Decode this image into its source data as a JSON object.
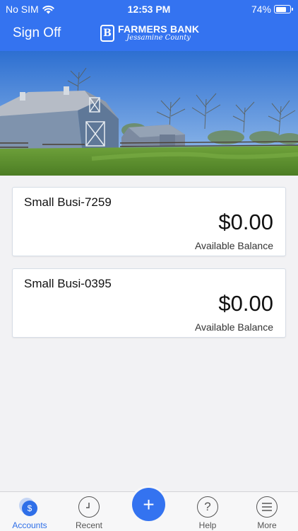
{
  "status_bar": {
    "carrier": "No SIM",
    "time": "12:53 PM",
    "battery": "74%",
    "battery_level": 0.74,
    "wifi_icon": "wifi-icon"
  },
  "header": {
    "sign_off_label": "Sign Off",
    "logo": {
      "name": "FARMERS BANK",
      "subtitle": "Jessamine County",
      "mark": "B"
    },
    "color": "#3473f0"
  },
  "accounts": [
    {
      "name": "Small Busi-7259",
      "amount": "$0.00",
      "label": "Available Balance"
    },
    {
      "name": "Small Busi-0395",
      "amount": "$0.00",
      "label": "Available Balance"
    }
  ],
  "tabbar": {
    "tabs": [
      {
        "label": "Accounts",
        "icon": "dollar-icon",
        "glyph": "$",
        "active": true
      },
      {
        "label": "Recent",
        "icon": "clock-icon",
        "glyph": ""
      },
      {
        "label": "Help",
        "icon": "question-icon",
        "glyph": "?"
      },
      {
        "label": "More",
        "icon": "menu-icon",
        "glyph": "≡"
      }
    ],
    "fab_glyph": "+",
    "accent": "#2f6fe8"
  }
}
